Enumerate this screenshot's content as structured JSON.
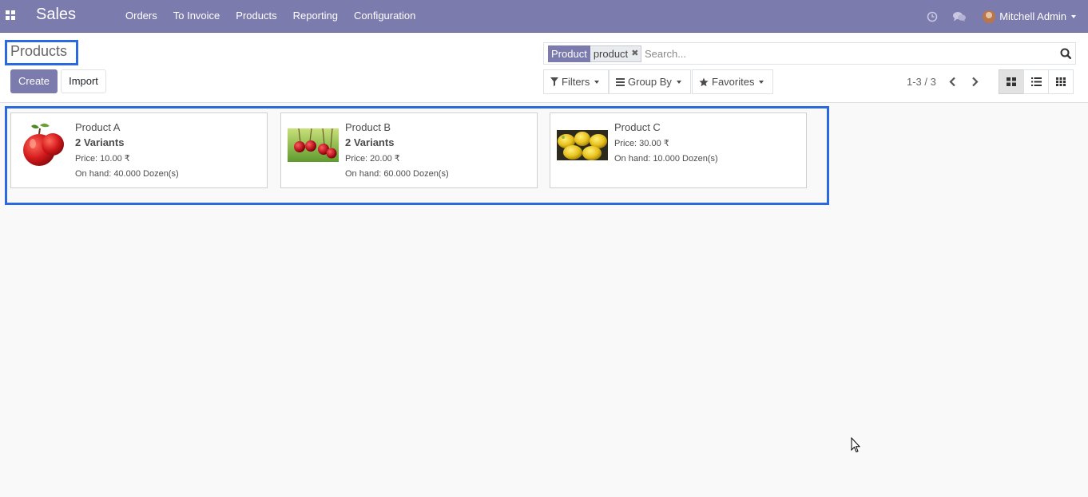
{
  "navbar": {
    "brand": "Sales",
    "menu": [
      "Orders",
      "To Invoice",
      "Products",
      "Reporting",
      "Configuration"
    ],
    "user_name": "Mitchell Admin",
    "bg_color": "#7c7bad"
  },
  "control_panel": {
    "title": "Products",
    "create_label": "Create",
    "import_label": "Import",
    "search": {
      "facet_label": "Product",
      "facet_value": "product",
      "placeholder": "Search..."
    },
    "filters_label": "Filters",
    "group_by_label": "Group By",
    "favorites_label": "Favorites",
    "pager": "1-3 / 3",
    "views": [
      "kanban",
      "list",
      "grid"
    ],
    "active_view": "kanban"
  },
  "products": [
    {
      "name": "Product A",
      "variants": "2 Variants",
      "price": "Price: 10.00 ₹",
      "on_hand": "On hand: 40.000 Dozen(s)",
      "image": "apple"
    },
    {
      "name": "Product B",
      "variants": "2 Variants",
      "price": "Price: 20.00 ₹",
      "on_hand": "On hand: 60.000 Dozen(s)",
      "image": "cherries"
    },
    {
      "name": "Product C",
      "price": "Price: 30.00 ₹",
      "on_hand": "On hand: 10.000 Dozen(s)",
      "image": "mangoes"
    }
  ],
  "icons": {
    "apps": "apps-grid-icon",
    "activity": "clock-icon",
    "messages": "chat-icon",
    "search": "search-icon",
    "filter": "funnel-icon",
    "group": "list-bars-icon",
    "favorites": "star-icon"
  }
}
